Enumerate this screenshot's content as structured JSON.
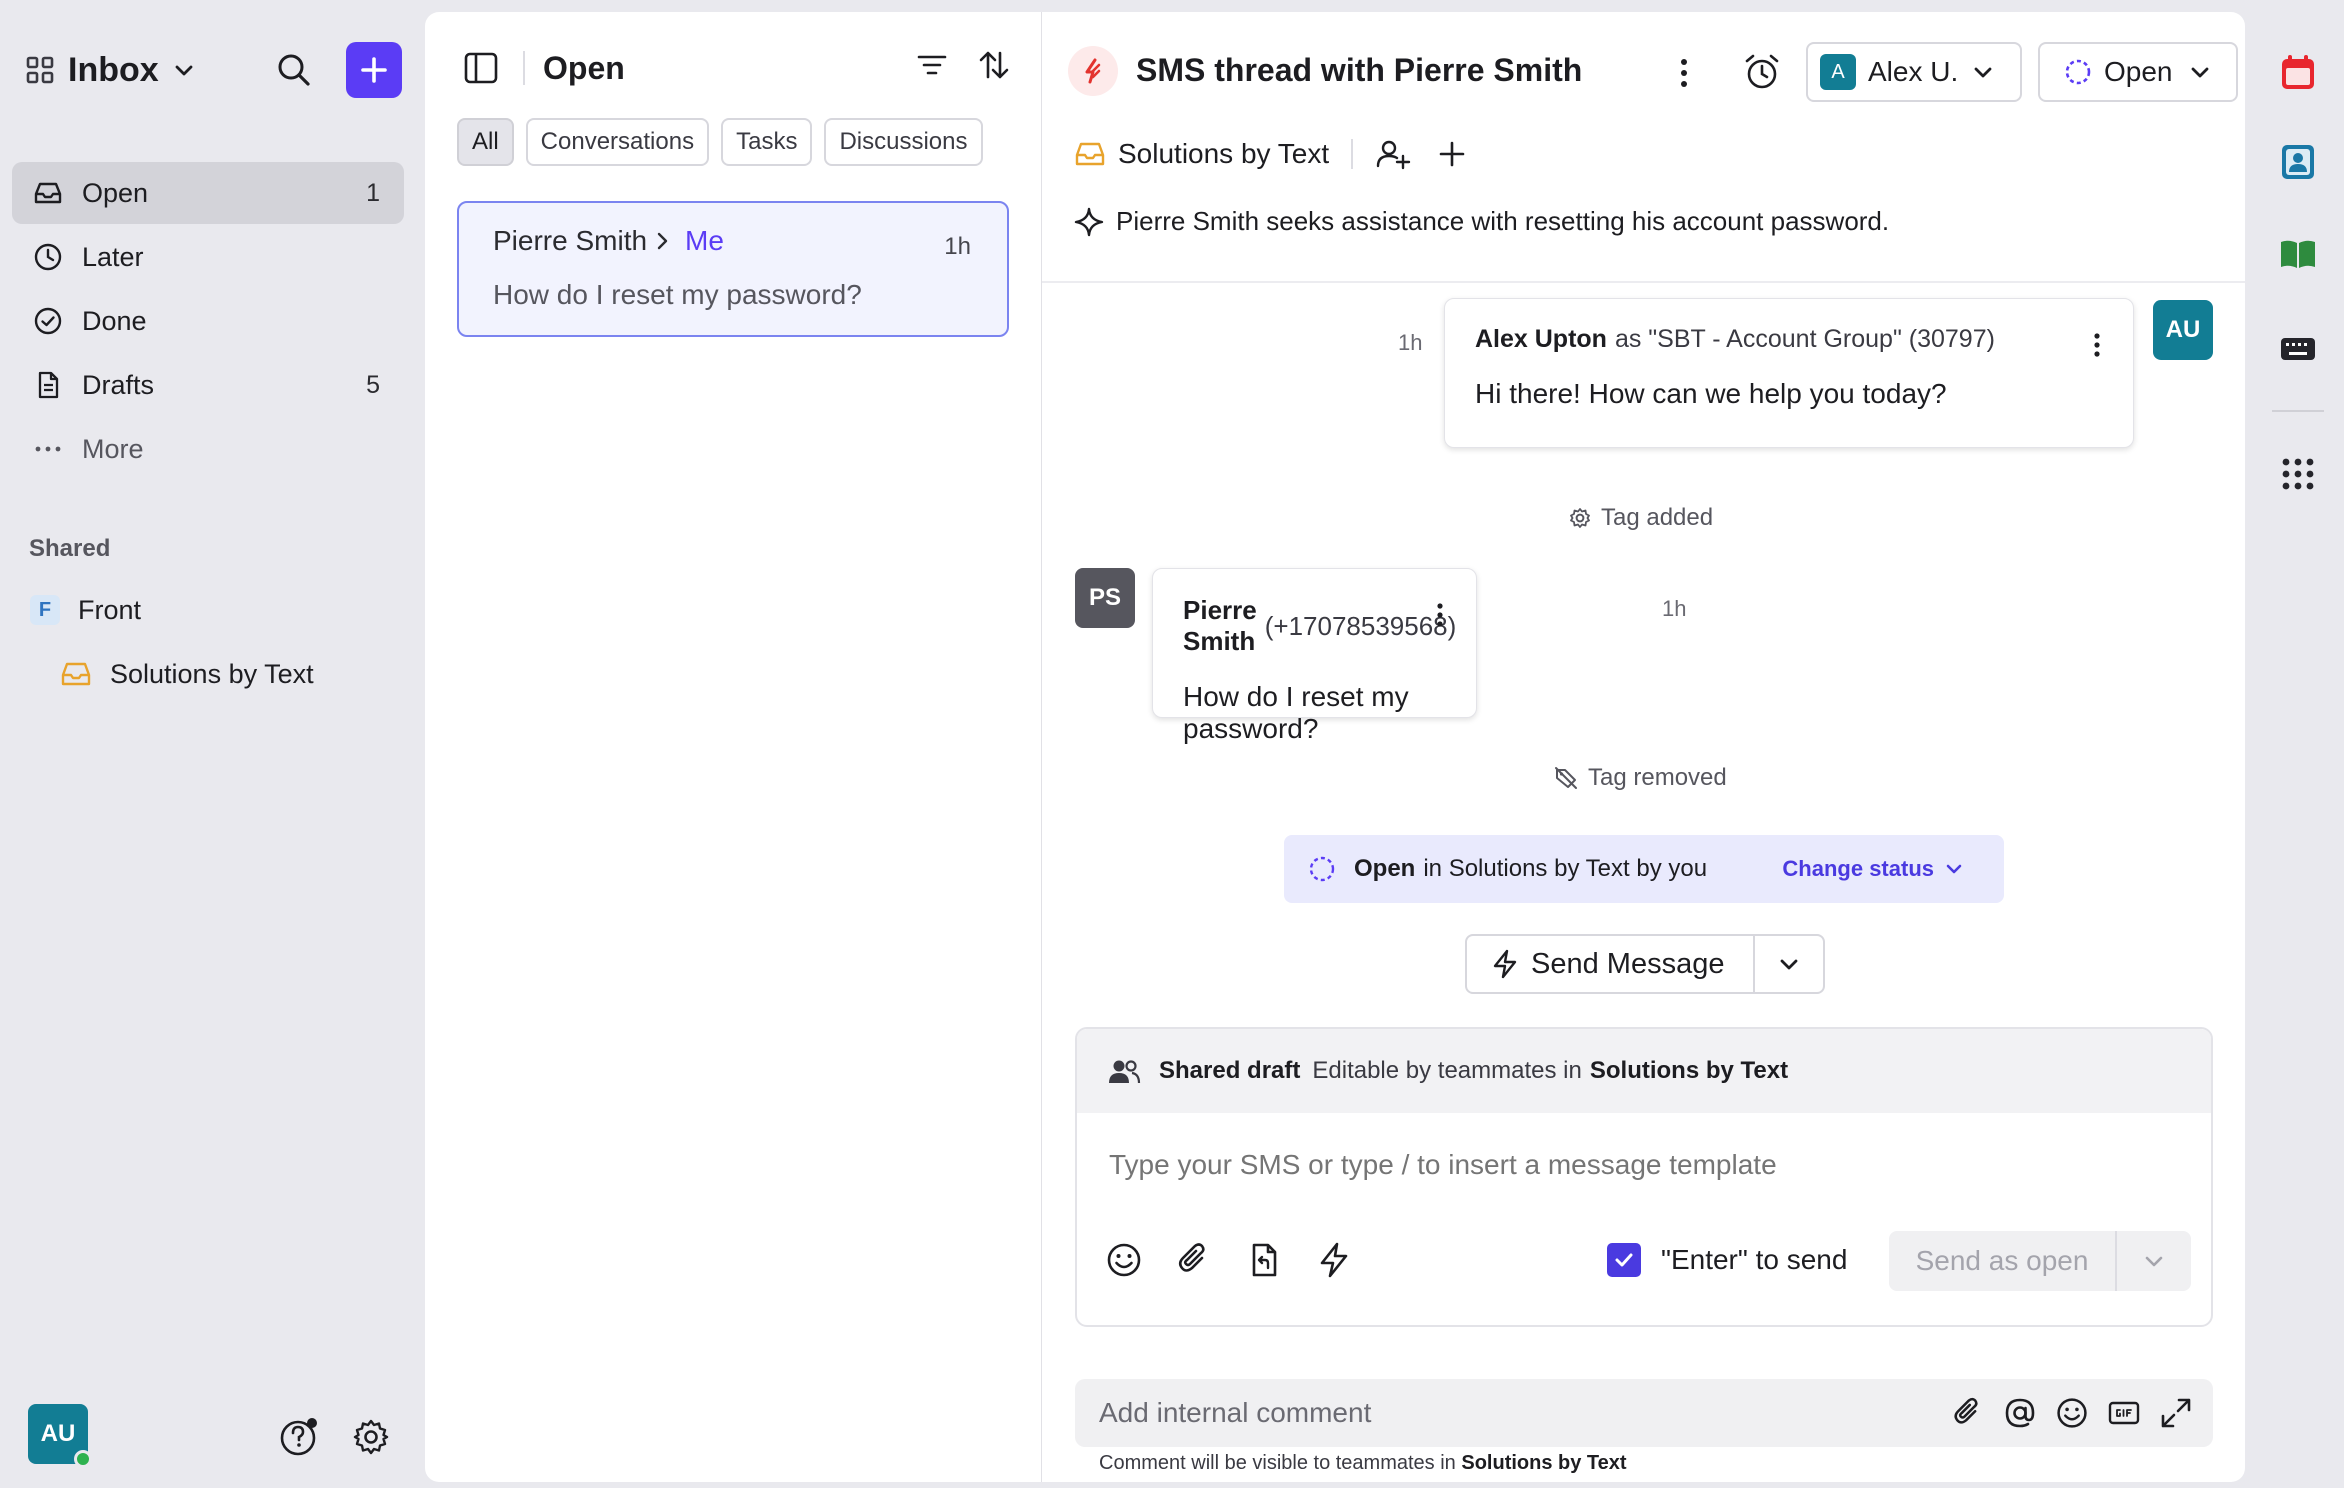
{
  "sidebar": {
    "inbox_title": "Inbox",
    "nav": [
      {
        "label": "Open",
        "count": "1",
        "icon": "inbox-tray-icon"
      },
      {
        "label": "Later",
        "count": "",
        "icon": "clock-icon"
      },
      {
        "label": "Done",
        "count": "",
        "icon": "check-circle-icon"
      },
      {
        "label": "Drafts",
        "count": "5",
        "icon": "document-icon"
      },
      {
        "label": "More",
        "count": "",
        "icon": "ellipsis-icon"
      }
    ],
    "shared_label": "Shared",
    "shared": {
      "team_badge": "F",
      "team_name": "Front",
      "inbox_name": "Solutions by Text"
    },
    "user_initials": "AU"
  },
  "list": {
    "title": "Open",
    "filters": [
      "All",
      "Conversations",
      "Tasks",
      "Discussions"
    ],
    "active_filter": "All",
    "conversation": {
      "from": "Pierre Smith",
      "to": "Me",
      "time": "1h",
      "preview": "How do I reset my password?"
    }
  },
  "conversation": {
    "title": "SMS thread with Pierre Smith",
    "assignee_initial": "A",
    "assignee_name": "Alex U.",
    "status": "Open",
    "inbox_tag": "Solutions by Text",
    "ai_summary": "Pierre Smith seeks assistance with resetting his account password.",
    "messages": [
      {
        "sender": "Alex Upton",
        "sender_detail": "as \"SBT - Account Group\" (30797)",
        "body": "Hi there! How can we help you today?",
        "time": "1h",
        "initials": "AU"
      },
      {
        "sender": "Pierre Smith",
        "sender_detail": "(+17078539568)",
        "body": "How do I reset my password?",
        "time": "1h",
        "initials": "PS"
      }
    ],
    "event_tag_added": "Tag added",
    "event_tag_removed": "Tag removed",
    "status_banner": {
      "status": "Open",
      "rest": "in Solutions by Text by you",
      "change": "Change status"
    },
    "send_message_label": "Send Message",
    "composer": {
      "shared_draft": "Shared draft",
      "editable_prefix": "Editable by teammates in",
      "editable_inbox": "Solutions by Text",
      "placeholder": "Type your SMS or type / to insert a message template",
      "enter_to_send": "\"Enter\" to send",
      "send_label": "Send as open"
    },
    "comment": {
      "placeholder": "Add internal comment",
      "note_prefix": "Comment will be visible to teammates in",
      "note_inbox": "Solutions by Text"
    }
  },
  "colors": {
    "accent": "#5b3cf5",
    "teal_avatar": "#127d94",
    "gray_avatar": "#56565e",
    "selected_card_border": "#7b84f0"
  }
}
